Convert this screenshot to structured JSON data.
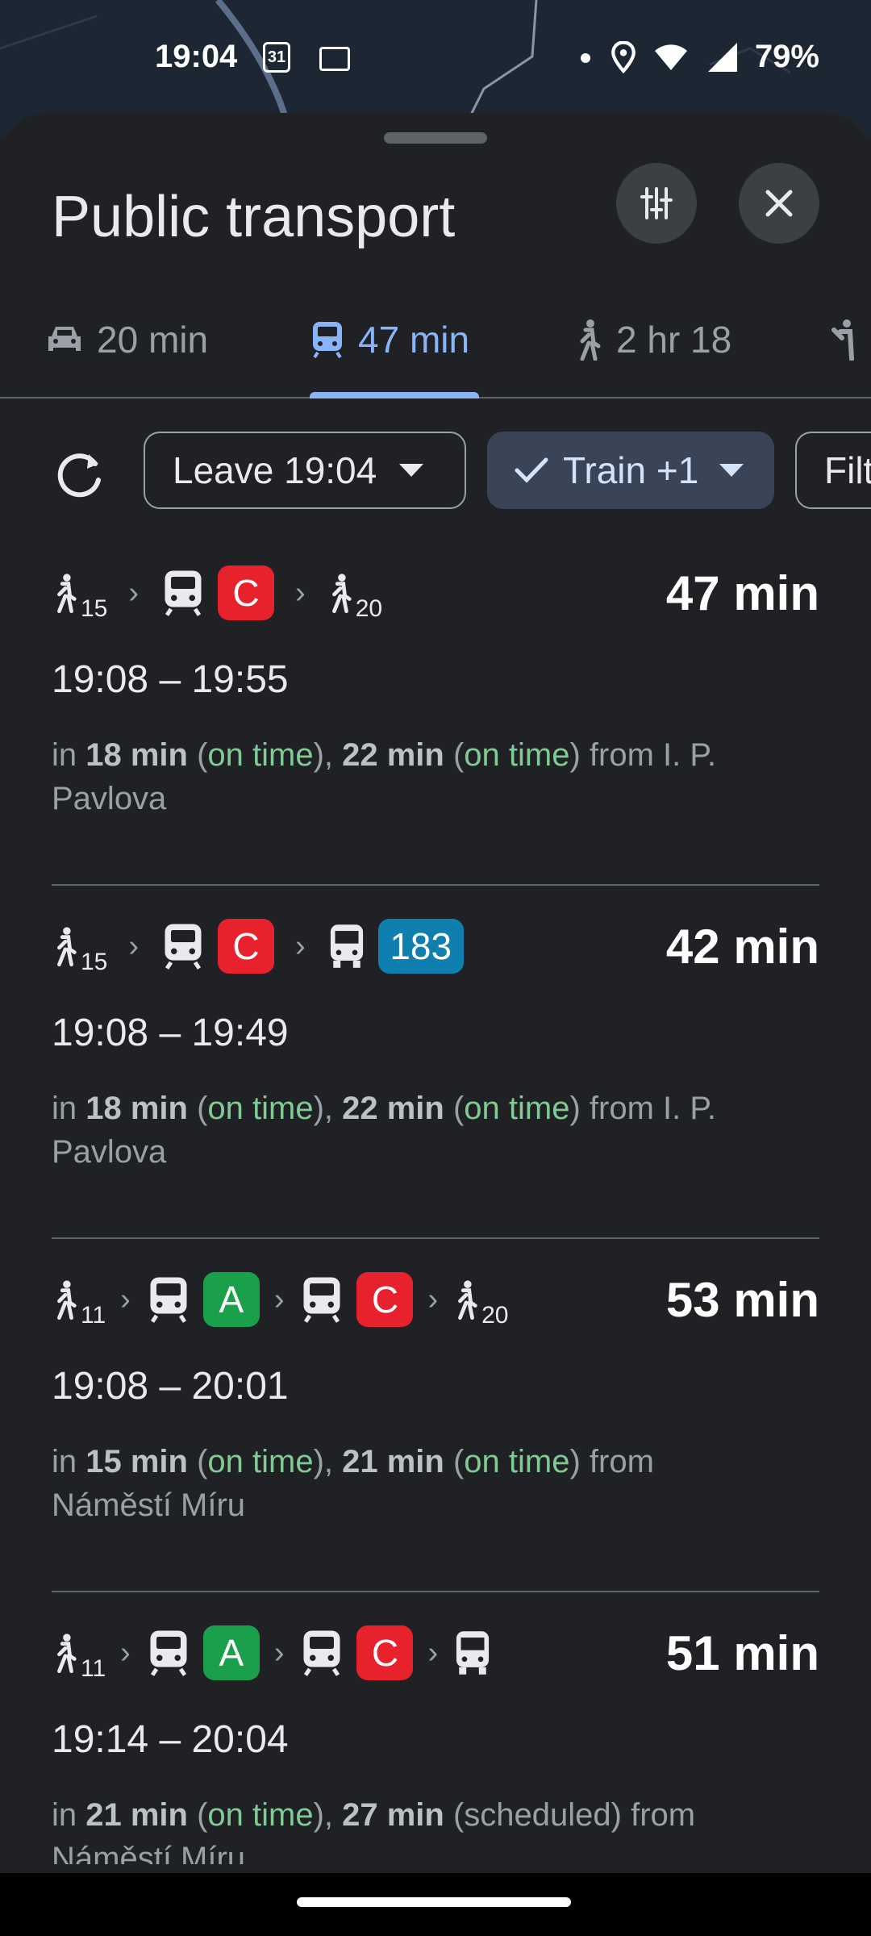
{
  "status_bar": {
    "time": "19:04",
    "calendar_day": "31",
    "battery": "79%"
  },
  "sheet": {
    "title": "Public transport",
    "options_icon": "tune-icon",
    "close_icon": "close-icon"
  },
  "tabs": [
    {
      "label": "20 min",
      "icon": "car-icon"
    },
    {
      "label": "47 min",
      "icon": "transit-icon"
    },
    {
      "label": "2 hr 18",
      "icon": "walk-icon"
    }
  ],
  "chips": {
    "leave": "Leave 19:04",
    "mode": "Train +1",
    "filter": "Filt"
  },
  "colors": {
    "line_c": "#e8222d",
    "line_a": "#1aa04a",
    "bus_183": "#0f7fb0"
  },
  "routes": [
    {
      "walk_start": "15",
      "line1": "C",
      "line2": "",
      "walk_end": "20",
      "duration": "47 min",
      "times": "19:08 – 19:55",
      "dep_in": "in ",
      "dep_t1": "18 min",
      "dep_s1": "on time",
      "dep_t2": "22 min",
      "dep_s2": "on time",
      "dep_from": " from I. P. Pavlova"
    },
    {
      "walk_start": "15",
      "line1": "C",
      "bus": "183",
      "duration": "42 min",
      "times": "19:08 – 19:49",
      "dep_in": "in ",
      "dep_t1": "18 min",
      "dep_s1": "on time",
      "dep_t2": "22 min",
      "dep_s2": "on time",
      "dep_from": " from I. P. Pavlova"
    },
    {
      "walk_start": "11",
      "line1": "A",
      "line2": "C",
      "walk_end": "20",
      "duration": "53 min",
      "times": "19:08 – 20:01",
      "dep_in": "in ",
      "dep_t1": "15 min",
      "dep_s1": "on time",
      "dep_t2": "21 min",
      "dep_s2": "on time",
      "dep_from": " from Náměstí Míru"
    },
    {
      "walk_start": "11",
      "line1": "A",
      "line2": "C",
      "duration": "51 min",
      "times": "19:14 – 20:04",
      "dep_in": "in ",
      "dep_t1": "21 min",
      "dep_s1": "on time",
      "dep_t2": "27 min",
      "dep_s2": "scheduled",
      "dep_from": " from Náměstí Míru"
    }
  ]
}
